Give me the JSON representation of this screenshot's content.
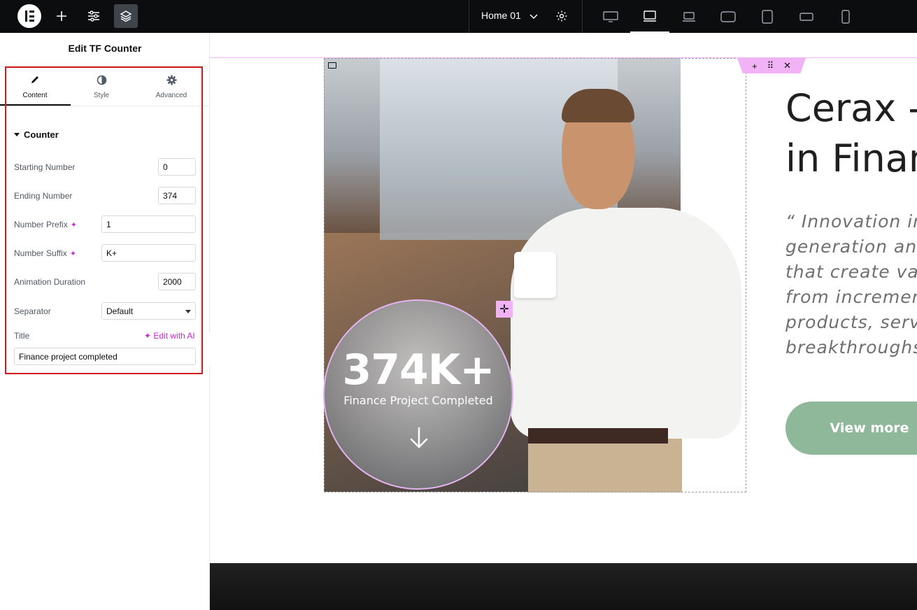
{
  "topbar": {
    "page_name": "Home 01"
  },
  "panel": {
    "title": "Edit TF Counter",
    "tabs": [
      {
        "label": "Content",
        "icon": "pencil-icon"
      },
      {
        "label": "Style",
        "icon": "half-circle-icon"
      },
      {
        "label": "Advanced",
        "icon": "gear-icon"
      }
    ],
    "section": "Counter",
    "fields": {
      "starting_number": {
        "label": "Starting Number",
        "value": "0"
      },
      "ending_number": {
        "label": "Ending Number",
        "value": "374"
      },
      "number_prefix": {
        "label": "Number Prefix",
        "value": "1"
      },
      "number_suffix": {
        "label": "Number Suffix",
        "value": "K+"
      },
      "animation_duration": {
        "label": "Animation Duration",
        "value": "2000"
      },
      "separator": {
        "label": "Separator",
        "value": "Default"
      },
      "title": {
        "label": "Title",
        "value": "Finance project completed",
        "ai_label": "Edit with AI"
      }
    }
  },
  "canvas": {
    "counter_value": "374K+",
    "counter_title": "Finance Project Completed",
    "heading_line1": "Cerax -",
    "heading_line2": "in Finan",
    "quote_lines": [
      "“ Innovation in",
      "generation an",
      "that create va",
      "from incremen",
      "products, serv",
      "breakthroughs"
    ],
    "button_label": "View more"
  },
  "colors": {
    "accent_pink": "#f1b3f5",
    "ai_purple": "#c22dcc",
    "button_green": "#8fb89a",
    "highlight_red": "#d31919"
  }
}
